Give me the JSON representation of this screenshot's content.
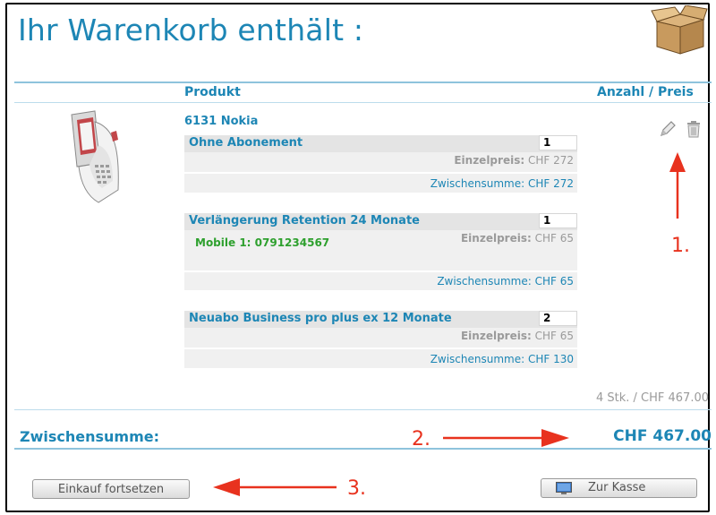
{
  "header": {
    "title": "Ihr Warenkorb enthält :"
  },
  "columns": {
    "product": "Produkt",
    "qty_price": "Anzahl / Preis"
  },
  "product": {
    "name": "6131 Nokia"
  },
  "items": [
    {
      "name": "Ohne Abonement",
      "qty": "1",
      "unit_label": "Einzelpreis:",
      "unit_price": "CHF 272",
      "subtotal": "Zwischensumme: CHF 272"
    },
    {
      "name": "Verlängerung Retention 24 Monate",
      "qty": "1",
      "mobile": "Mobile 1: 0791234567",
      "unit_label": "Einzelpreis:",
      "unit_price": "CHF 65",
      "subtotal": "Zwischensumme: CHF 65"
    },
    {
      "name": "Neuabo Business pro plus ex 12 Monate",
      "qty": "2",
      "unit_label": "Einzelpreis:",
      "unit_price": "CHF 65",
      "subtotal": "Zwischensumme: CHF 130"
    }
  ],
  "totals": {
    "count": "4 Stk. / CHF 467.00",
    "subtotal_label": "Zwischensumme:",
    "subtotal_value": "CHF 467.00"
  },
  "annotations": {
    "a1": "1.",
    "a2": "2.",
    "a3": "3."
  },
  "buttons": {
    "continue": "Einkauf fortsetzen",
    "checkout": "Zur Kasse"
  },
  "colors": {
    "accent": "#1d86b5",
    "annotation": "#e8321e",
    "mobile": "#2ea02e"
  },
  "icons": {
    "edit": "pencil-icon",
    "delete": "trash-icon",
    "cart": "cardboard-box-icon",
    "checkout": "monitor-icon"
  }
}
